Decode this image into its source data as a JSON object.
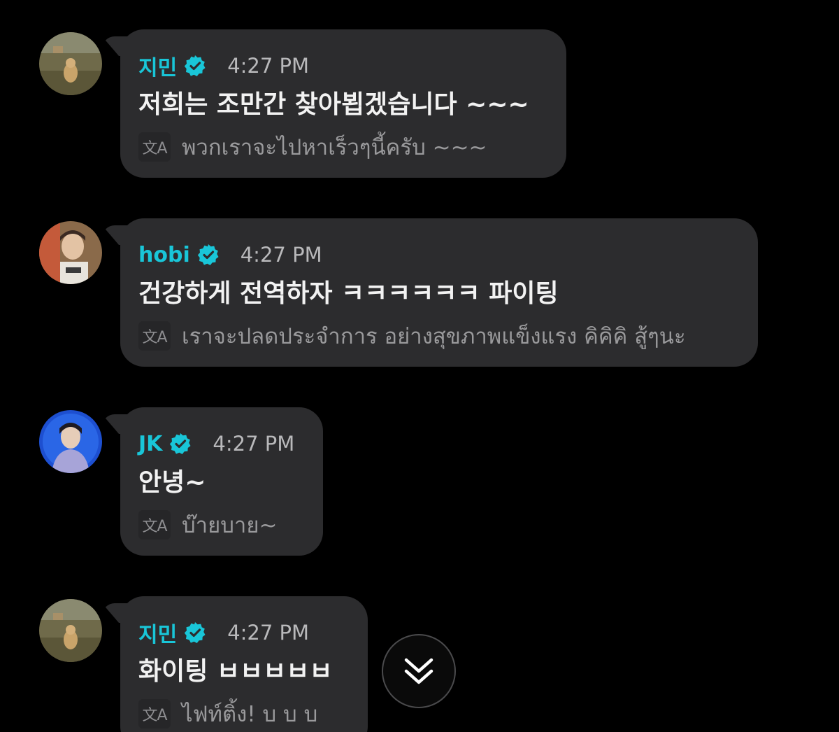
{
  "accent_color": "#19c6d8",
  "messages": [
    {
      "sender": "지민",
      "time": "4:27 PM",
      "text": "저희는 조만간 찾아뵙겠습니다 ~~~",
      "translation": "พวกเราจะไปหาเร็วๆนี้ครับ ~~~",
      "avatar": "avatar-dog"
    },
    {
      "sender": "hobi",
      "time": "4:27 PM",
      "text": "건강하게 전역하자 ㅋㅋㅋㅋㅋㅋ 파이팅",
      "translation": "เราจะปลดประจำการ อย่างสุขภาพแข็งแรง คิคิคิ สู้ๆนะ",
      "avatar": "avatar-hobi"
    },
    {
      "sender": "JK",
      "time": "4:27 PM",
      "text": "안녕~",
      "translation": "บ๊ายบาย~",
      "avatar": "avatar-jk"
    },
    {
      "sender": "지민",
      "time": "4:27 PM",
      "text": "화이팅 ㅂㅂㅂㅂㅂ",
      "translation": "ไฟท์ติ้ง! บ บ บ",
      "avatar": "avatar-dog"
    }
  ],
  "translate_icon_label": "文A",
  "icons": {
    "verified": "verified-badge-icon",
    "translate": "translate-icon",
    "scroll_down": "double-chevron-down-icon"
  }
}
